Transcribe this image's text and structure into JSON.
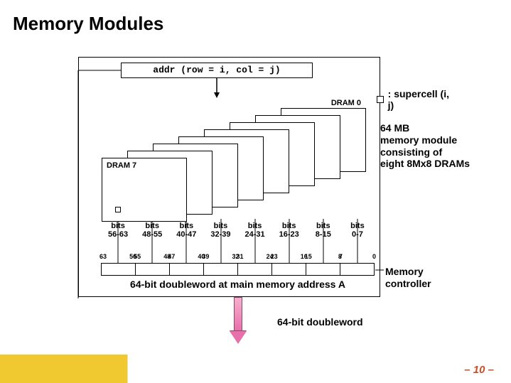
{
  "title": "Memory Modules",
  "addr_label": "addr (row = i, col = j)",
  "supercell_legend": ": supercell (i, j)",
  "module_desc_lines": [
    "64 MB",
    "memory module",
    "consisting of",
    "eight 8Mx8 DRAMs"
  ],
  "dram_first": "DRAM 0",
  "dram_last": "DRAM 7",
  "bit_ranges": [
    {
      "l1": "bits",
      "l2": "56-63"
    },
    {
      "l1": "bits",
      "l2": "48-55"
    },
    {
      "l1": "bits",
      "l2": "40-47"
    },
    {
      "l1": "bits",
      "l2": "32-39"
    },
    {
      "l1": "bits",
      "l2": "24-31"
    },
    {
      "l1": "bits",
      "l2": "16-23"
    },
    {
      "l1": "bits",
      "l2": "8-15"
    },
    {
      "l1": "bits",
      "l2": "0-7"
    }
  ],
  "reg_boundaries": [
    {
      "l": "63",
      "r": "56"
    },
    {
      "l": "55",
      "r": "48"
    },
    {
      "l": "47",
      "r": "40"
    },
    {
      "l": "39",
      "r": "32"
    },
    {
      "l": "31",
      "r": "24"
    },
    {
      "l": "23",
      "r": "16"
    },
    {
      "l": "15",
      "r": "8"
    },
    {
      "l": "7",
      "r": "0"
    }
  ],
  "reg_caption": "64-bit doubleword at main memory address A",
  "mem_controller": "Memory controller",
  "dword_label": "64-bit doubleword",
  "page_num": "– 10 –"
}
